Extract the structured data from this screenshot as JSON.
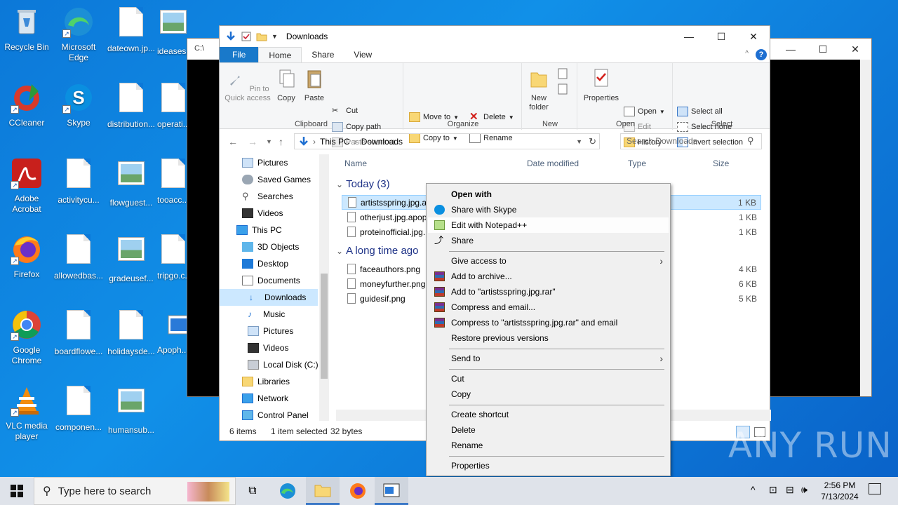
{
  "desktop_icons": [
    {
      "label": "Recycle Bin"
    },
    {
      "label": "Microsoft Edge"
    },
    {
      "label": "dateown.jp..."
    },
    {
      "label": "ideases..."
    },
    {
      "label": "CCleaner"
    },
    {
      "label": "Skype"
    },
    {
      "label": "distribution..."
    },
    {
      "label": "operati..."
    },
    {
      "label": "Adobe Acrobat"
    },
    {
      "label": "activitycu..."
    },
    {
      "label": "flowguest..."
    },
    {
      "label": "tooacc..."
    },
    {
      "label": "Firefox"
    },
    {
      "label": "allowedbas..."
    },
    {
      "label": "gradeusef..."
    },
    {
      "label": "tripgo.c..."
    },
    {
      "label": "Google Chrome"
    },
    {
      "label": "boardflowe..."
    },
    {
      "label": "holidaysde..."
    },
    {
      "label": "Apoph..."
    },
    {
      "label": "VLC media player"
    },
    {
      "label": "componen..."
    },
    {
      "label": "humansub..."
    }
  ],
  "back_window": {
    "title": "C:\\",
    "min": "—",
    "max": "☐",
    "close": "✕"
  },
  "explorer": {
    "title": "Downloads",
    "controls": {
      "min": "—",
      "max": "☐",
      "close": "✕"
    },
    "tabs": {
      "file": "File",
      "home": "Home",
      "share": "Share",
      "view": "View"
    },
    "ribbon": {
      "pin": "Pin to Quick access",
      "copy": "Copy",
      "paste": "Paste",
      "cut": "Cut",
      "copy_path": "Copy path",
      "paste_shortcut": "Paste shortcut",
      "clipboard": "Clipboard",
      "move_to": "Move to",
      "copy_to": "Copy to",
      "delete": "Delete",
      "rename": "Rename",
      "organize": "Organize",
      "new_folder": "New folder",
      "new": "New",
      "properties": "Properties",
      "open": "Open",
      "edit": "Edit",
      "history": "History",
      "open_group": "Open",
      "select_all": "Select all",
      "select_none": "Select none",
      "invert_selection": "Invert selection",
      "select": "Select"
    },
    "address": {
      "root": "This PC",
      "folder": "Downloads"
    },
    "search_placeholder": "Search Downloads",
    "tree": [
      "Pictures",
      "Saved Games",
      "Searches",
      "Videos",
      "This PC",
      "3D Objects",
      "Desktop",
      "Documents",
      "Downloads",
      "Music",
      "Pictures",
      "Videos",
      "Local Disk (C:)",
      "Libraries",
      "Network",
      "Control Panel"
    ],
    "columns": {
      "name": "Name",
      "date": "Date modified",
      "type": "Type",
      "size": "Size"
    },
    "groups": {
      "today": "Today (3)",
      "long_ago": "A long time ago"
    },
    "files_today": [
      {
        "name": "artistsspring.jpg.ap",
        "size": "1 KB"
      },
      {
        "name": "otherjust.jpg.apop",
        "size": "1 KB"
      },
      {
        "name": "proteinofficial.jpg.",
        "size": "1 KB"
      }
    ],
    "files_old": [
      {
        "name": "faceauthors.png",
        "size": "4 KB"
      },
      {
        "name": "moneyfurther.png",
        "size": "6 KB"
      },
      {
        "name": "guidesif.png",
        "size": "5 KB"
      }
    ],
    "status": {
      "items": "6 items",
      "selected": "1 item selected",
      "bytes": "32 bytes"
    }
  },
  "context_menu": {
    "open_with": "Open with",
    "share_skype": "Share with Skype",
    "edit_npp": "Edit with Notepad++",
    "share": "Share",
    "give_access": "Give access to",
    "add_archive": "Add to archive...",
    "add_rar": "Add to \"artistsspring.jpg.rar\"",
    "compress_email": "Compress and email...",
    "compress_rar_email": "Compress to \"artistsspring.jpg.rar\" and email",
    "restore": "Restore previous versions",
    "send_to": "Send to",
    "cut": "Cut",
    "copy": "Copy",
    "create_shortcut": "Create shortcut",
    "delete": "Delete",
    "rename": "Rename",
    "properties": "Properties"
  },
  "taskbar": {
    "search_placeholder": "Type here to search",
    "time": "2:56 PM",
    "date": "7/13/2024"
  },
  "watermark": "ANY RUN"
}
